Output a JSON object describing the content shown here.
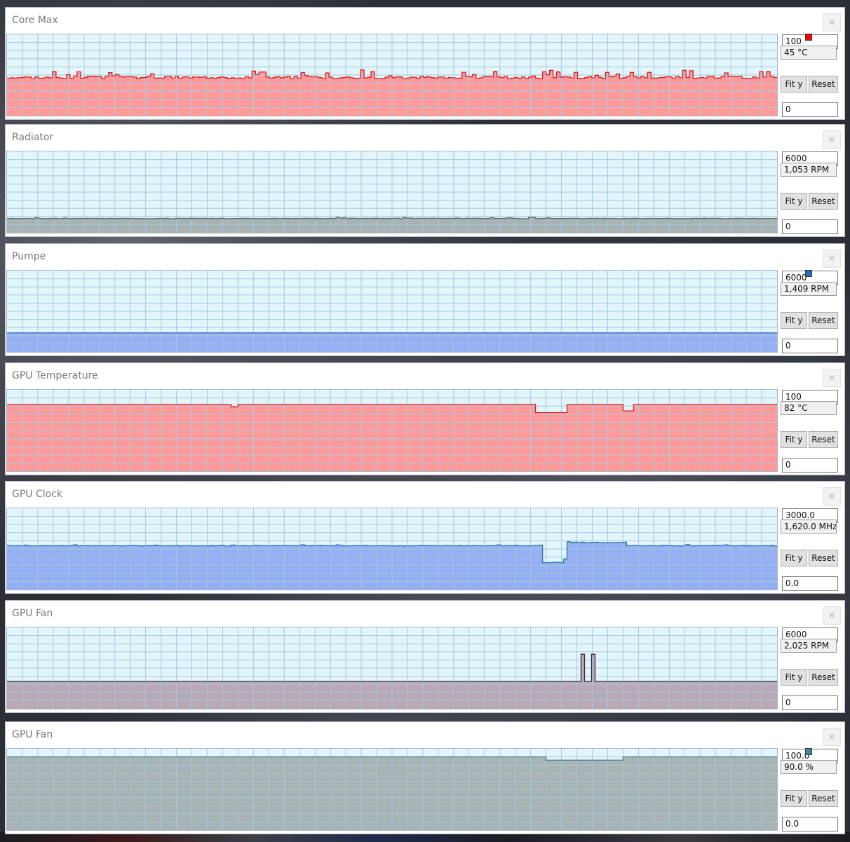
{
  "panels": [
    {
      "title": "Core Max",
      "max": "100",
      "current": "45 °C",
      "min": "0",
      "color": "#ff0000",
      "fill": "#ff9a9a",
      "stroke": "#d61e1e",
      "swatch": true,
      "fit_label": "Fit y",
      "reset_label": "Reset",
      "close_label": "✕",
      "ymin": 0,
      "ymax": 100,
      "baseline": 47,
      "pattern": "noisy-up",
      "events": []
    },
    {
      "title": "Radiator",
      "max": "6000",
      "current": "1,053 RPM",
      "min": "0",
      "color": "#6e8c84",
      "fill": "#a8b4b4",
      "stroke": "#4f6e66",
      "swatch": false,
      "fit_label": "Fit y",
      "reset_label": "Reset",
      "close_label": "✕",
      "ymin": 0,
      "ymax": 6000,
      "baseline": 1053,
      "pattern": "flat-noise",
      "events": []
    },
    {
      "title": "Pumpe",
      "max": "6000",
      "current": "1,409 RPM",
      "min": "0",
      "color": "#1e6fb3",
      "fill": "#94aff2",
      "stroke": "#2f6fb8",
      "swatch": true,
      "fit_label": "Fit y",
      "reset_label": "Reset",
      "close_label": "✕",
      "ymin": 0,
      "ymax": 6000,
      "baseline": 1409,
      "pattern": "flat",
      "events": []
    },
    {
      "title": "GPU Temperature",
      "max": "100",
      "current": "82 °C",
      "min": "0",
      "color": "#ff0000",
      "fill": "#ff9a9a",
      "stroke": "#d61e1e",
      "swatch": false,
      "fit_label": "Fit y",
      "reset_label": "Reset",
      "close_label": "✕",
      "ymin": 0,
      "ymax": 100,
      "baseline": 82,
      "pattern": "flat",
      "events": [
        {
          "at": 0.29,
          "len": 0.008,
          "depth": -3
        },
        {
          "at": 0.685,
          "len": 0.04,
          "depth": -10
        },
        {
          "at": 0.8,
          "len": 0.01,
          "depth": -8
        }
      ]
    },
    {
      "title": "GPU Clock",
      "max": "3000.0",
      "current": "1,620.0 MHz",
      "min": "0.0",
      "color": "#2f8fc8",
      "fill": "#94aff2",
      "stroke": "#2a78a8",
      "swatch": false,
      "fit_label": "Fit y",
      "reset_label": "Reset",
      "close_label": "✕",
      "ymin": 0,
      "ymax": 3000,
      "baseline": 1620,
      "pattern": "flat-noise",
      "events": [
        {
          "at": 0.695,
          "len": 0.028,
          "depth": -630
        },
        {
          "at": 0.722,
          "len": 0.08,
          "depth": 120
        },
        {
          "at": 0.805,
          "len": 0.004,
          "depth": -600
        }
      ]
    },
    {
      "title": "GPU Fan",
      "max": "6000",
      "current": "2,025 RPM",
      "min": "0",
      "color": "#4a2a4a",
      "fill": "#b9a9b6",
      "stroke": "#3b2a3b",
      "swatch": false,
      "fit_label": "Fit y",
      "reset_label": "Reset",
      "close_label": "✕",
      "ymin": 0,
      "ymax": 6000,
      "baseline": 2025,
      "pattern": "flat",
      "events": [
        {
          "at": 0.745,
          "len": 0.003,
          "depth": 2000
        },
        {
          "at": 0.758,
          "len": 0.003,
          "depth": 2000
        },
        {
          "at": 0.774,
          "len": 0.003,
          "depth": 2000
        },
        {
          "at": 0.815,
          "len": 0.003,
          "depth": 2000
        }
      ]
    },
    {
      "title": "GPU Fan",
      "max": "100.0",
      "current": "90.0 %",
      "min": "0.0",
      "color": "#3a8a9a",
      "fill": "#a8b4b4",
      "stroke": "#4a7e8e",
      "swatch": true,
      "fit_label": "Fit y",
      "reset_label": "Reset",
      "close_label": "✕",
      "ymin": 0,
      "ymax": 100,
      "baseline": 90,
      "pattern": "flat",
      "events": [
        {
          "at": 0.7,
          "len": 0.1,
          "depth": -4
        }
      ]
    }
  ]
}
